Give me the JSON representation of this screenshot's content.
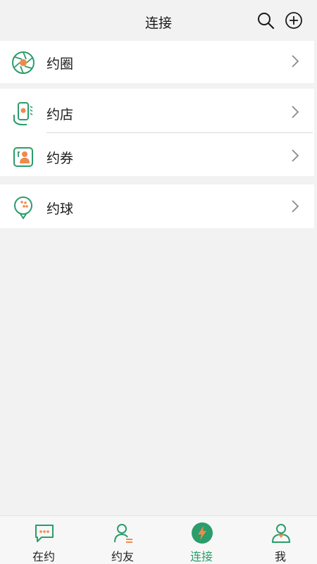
{
  "header": {
    "title": "连接",
    "search_icon": "search-icon",
    "add_icon": "plus-circle-icon"
  },
  "groups": [
    {
      "items": [
        {
          "label": "约圈",
          "icon": "shutter-icon"
        }
      ]
    },
    {
      "items": [
        {
          "label": "约店",
          "icon": "phone-hand-icon"
        },
        {
          "label": "约券",
          "icon": "coupon-icon"
        }
      ]
    },
    {
      "items": [
        {
          "label": "约球",
          "icon": "golf-ball-icon"
        }
      ]
    }
  ],
  "tabbar": {
    "tabs": [
      {
        "label": "在约",
        "icon": "chat-bubble-icon",
        "active": false
      },
      {
        "label": "约友",
        "icon": "friend-icon",
        "active": false
      },
      {
        "label": "连接",
        "icon": "connect-bolt-icon",
        "active": true
      },
      {
        "label": "我",
        "icon": "user-icon",
        "active": false
      }
    ]
  },
  "colors": {
    "accent": "#2a9d6b",
    "accent_orange": "#f08a4b",
    "background": "#f2f2f2",
    "card": "#ffffff",
    "divider": "#d9d9d9",
    "chevron": "#8a8a8a"
  }
}
